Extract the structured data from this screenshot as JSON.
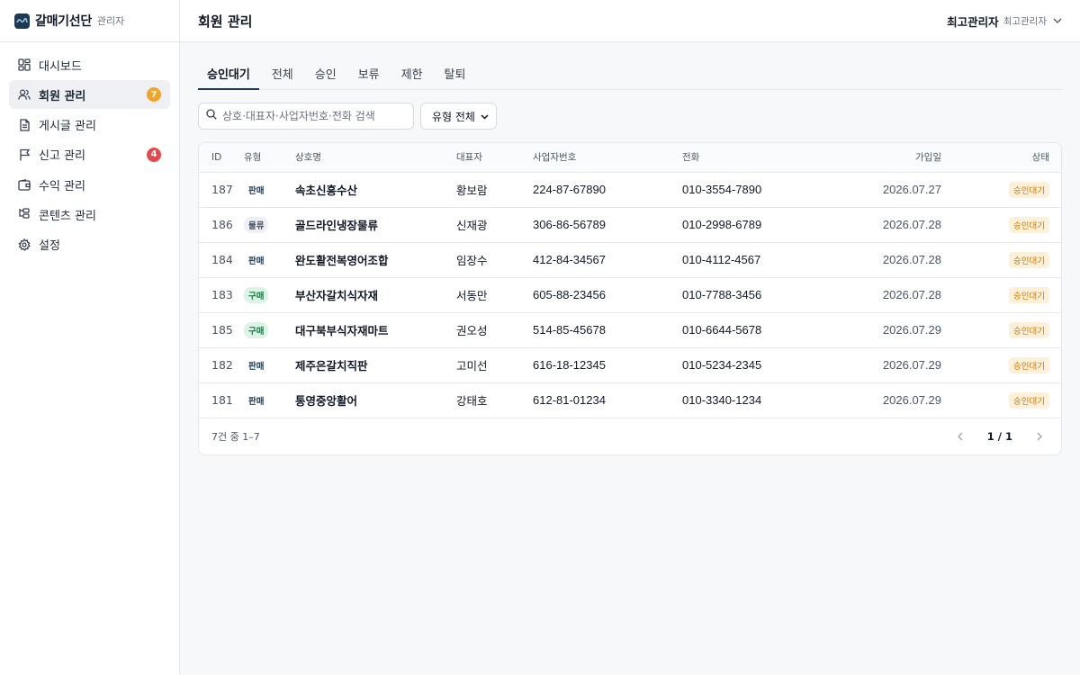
{
  "brand": {
    "name": "갈매기선단",
    "sub": "관리자",
    "icon": "wave-logo-icon"
  },
  "sidebar": {
    "items": [
      {
        "label": "대시보드",
        "icon": "dashboard-icon",
        "active": false,
        "badge": ""
      },
      {
        "label": "회원 관리",
        "icon": "users-icon",
        "active": true,
        "badge": "7"
      },
      {
        "label": "게시글 관리",
        "icon": "document-icon",
        "active": false,
        "badge": ""
      },
      {
        "label": "신고 관리",
        "icon": "flag-icon",
        "active": false,
        "badge": "4"
      },
      {
        "label": "수익 관리",
        "icon": "wallet-icon",
        "active": false,
        "badge": ""
      },
      {
        "label": "콘텐츠 관리",
        "icon": "content-icon",
        "active": false,
        "badge": ""
      },
      {
        "label": "설정",
        "icon": "gear-icon",
        "active": false,
        "badge": ""
      }
    ]
  },
  "header": {
    "title": "회원 관리",
    "user_name": "최고관리자",
    "user_role": "최고관리자"
  },
  "tabs": [
    {
      "label": "승인대기",
      "active": true
    },
    {
      "label": "전체",
      "active": false
    },
    {
      "label": "승인",
      "active": false
    },
    {
      "label": "보류",
      "active": false
    },
    {
      "label": "제한",
      "active": false
    },
    {
      "label": "탈퇴",
      "active": false
    }
  ],
  "search": {
    "placeholder": "상호·대표자·사업자번호·전화 검색",
    "value": ""
  },
  "type_filter": {
    "selected": "유형 전체"
  },
  "table": {
    "columns": {
      "id": "ID",
      "type": "유형",
      "name": "상호명",
      "ceo": "대표자",
      "biz": "사업자번호",
      "phone": "전화",
      "date": "가입일",
      "status": "상태"
    },
    "rows": [
      {
        "id": "187",
        "type": "판매",
        "name": "속초신흥수산",
        "ceo": "황보람",
        "biz": "224-87-67890",
        "phone": "010-3554-7890",
        "date": "2026.07.27",
        "status": "승인대기"
      },
      {
        "id": "186",
        "type": "물류",
        "name": "골드라인냉장물류",
        "ceo": "신재광",
        "biz": "306-86-56789",
        "phone": "010-2998-6789",
        "date": "2026.07.28",
        "status": "승인대기"
      },
      {
        "id": "184",
        "type": "판매",
        "name": "완도활전복영어조합",
        "ceo": "임장수",
        "biz": "412-84-34567",
        "phone": "010-4112-4567",
        "date": "2026.07.28",
        "status": "승인대기"
      },
      {
        "id": "183",
        "type": "구매",
        "name": "부산자갈치식자재",
        "ceo": "서동만",
        "biz": "605-88-23456",
        "phone": "010-7788-3456",
        "date": "2026.07.28",
        "status": "승인대기"
      },
      {
        "id": "185",
        "type": "구매",
        "name": "대구북부식자재마트",
        "ceo": "권오성",
        "biz": "514-85-45678",
        "phone": "010-6644-5678",
        "date": "2026.07.29",
        "status": "승인대기"
      },
      {
        "id": "182",
        "type": "판매",
        "name": "제주은갈치직판",
        "ceo": "고미선",
        "biz": "616-18-12345",
        "phone": "010-5234-2345",
        "date": "2026.07.29",
        "status": "승인대기"
      },
      {
        "id": "181",
        "type": "판매",
        "name": "통영중앙활어",
        "ceo": "강태호",
        "biz": "612-81-01234",
        "phone": "010-3340-1234",
        "date": "2026.07.29",
        "status": "승인대기"
      }
    ]
  },
  "footer": {
    "count_text": "7건 중 1–7",
    "page_text": "1 / 1"
  }
}
